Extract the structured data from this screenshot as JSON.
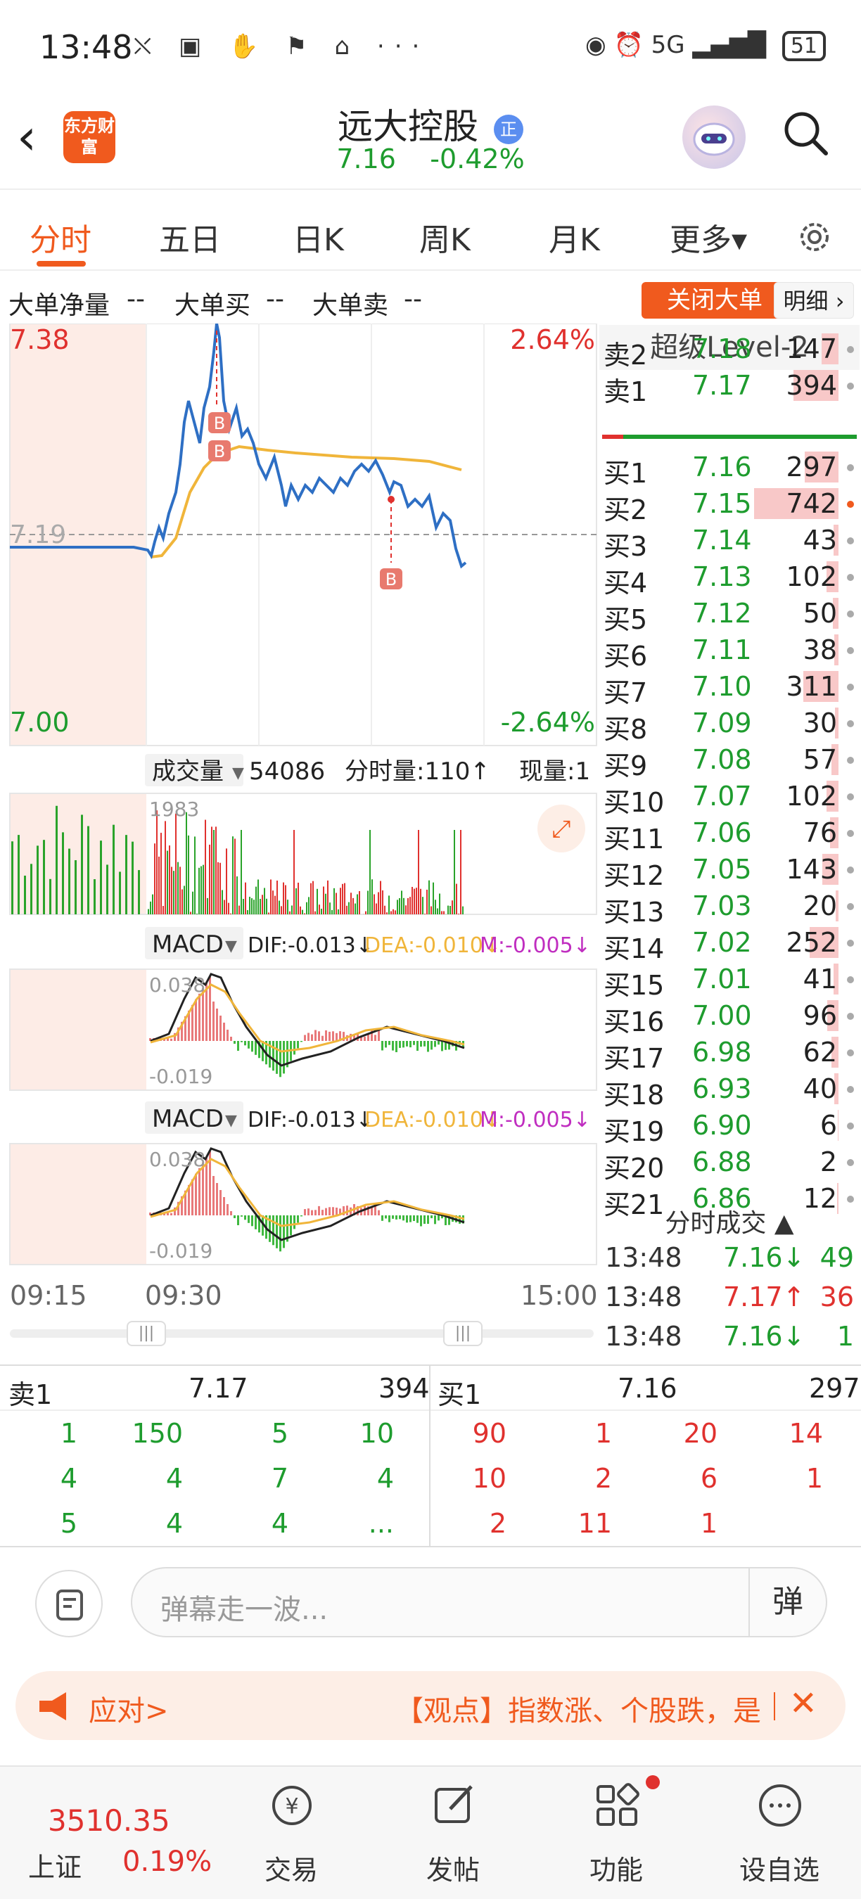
{
  "status_bar": {
    "time": "13:48",
    "icons": "⛌ ▣ ✋ ⚑ ⌂ ···",
    "network": "5G",
    "battery": "51"
  },
  "header": {
    "logo": "东方财富",
    "stock_name": "远大控股",
    "name_tag": "正",
    "price": "7.16",
    "change": "-0.42%"
  },
  "tabs": [
    "分时",
    "五日",
    "日K",
    "周K",
    "月K",
    "更多▾"
  ],
  "large_order": {
    "net_label": "大单净量",
    "net_value": "--",
    "buy_label": "大单买",
    "buy_value": "--",
    "sell_label": "大单卖",
    "sell_value": "--",
    "close_button": "关闭大单",
    "detail_button": "明细"
  },
  "chart_data": [
    {
      "type": "line",
      "title": "",
      "y_labels": {
        "top": "7.38",
        "bottom": "7.00",
        "ref": "7.19",
        "pct_top": "2.64%",
        "pct_bottom": "-2.64%"
      },
      "ylim": [
        7.0,
        7.38
      ],
      "x_labels": [
        "09:15",
        "09:30",
        "15:00"
      ],
      "series": [
        {
          "name": "price",
          "color": "#2e6fc4"
        },
        {
          "name": "average",
          "color": "#f0b53a"
        }
      ],
      "markers": [
        "B",
        "B",
        "B"
      ]
    },
    {
      "type": "bar",
      "title": "成交量",
      "total": "54086",
      "minute_volume_label": "分时量:110↑",
      "current_label": "现量:1",
      "max_label": "1983"
    },
    {
      "type": "bar",
      "title": "MACD",
      "dif": "DIF:-0.013↓",
      "dea": "DEA:-0.010↓",
      "m": "M:-0.005↓",
      "top_label": "0.038",
      "bottom_label": "-0.019"
    },
    {
      "type": "bar",
      "title": "MACD",
      "dif": "DIF:-0.013↓",
      "dea": "DEA:-0.010↓",
      "m": "M:-0.005↓",
      "top_label": "0.038",
      "bottom_label": "-0.019"
    }
  ],
  "orderbook": {
    "title": "超级Level-2",
    "sells": [
      {
        "label": "卖2",
        "price": "7.18",
        "volume": "147",
        "bar": 0.2
      },
      {
        "label": "卖1",
        "price": "7.17",
        "volume": "394",
        "bar": 0.53
      }
    ],
    "buys": [
      {
        "label": "买1",
        "price": "7.16",
        "volume": "297",
        "bar": 0.4
      },
      {
        "label": "买2",
        "price": "7.15",
        "volume": "742",
        "bar": 1.0,
        "hot": true
      },
      {
        "label": "买3",
        "price": "7.14",
        "volume": "43",
        "bar": 0.06
      },
      {
        "label": "买4",
        "price": "7.13",
        "volume": "102",
        "bar": 0.14
      },
      {
        "label": "买5",
        "price": "7.12",
        "volume": "50",
        "bar": 0.07
      },
      {
        "label": "买6",
        "price": "7.11",
        "volume": "38",
        "bar": 0.05
      },
      {
        "label": "买7",
        "price": "7.10",
        "volume": "311",
        "bar": 0.42
      },
      {
        "label": "买8",
        "price": "7.09",
        "volume": "30",
        "bar": 0.04
      },
      {
        "label": "买9",
        "price": "7.08",
        "volume": "57",
        "bar": 0.08
      },
      {
        "label": "买10",
        "price": "7.07",
        "volume": "102",
        "bar": 0.14
      },
      {
        "label": "买11",
        "price": "7.06",
        "volume": "76",
        "bar": 0.1
      },
      {
        "label": "买12",
        "price": "7.05",
        "volume": "143",
        "bar": 0.19
      },
      {
        "label": "买13",
        "price": "7.03",
        "volume": "20",
        "bar": 0.03
      },
      {
        "label": "买14",
        "price": "7.02",
        "volume": "252",
        "bar": 0.34
      },
      {
        "label": "买15",
        "price": "7.01",
        "volume": "41",
        "bar": 0.06
      },
      {
        "label": "买16",
        "price": "7.00",
        "volume": "96",
        "bar": 0.13
      },
      {
        "label": "买17",
        "price": "6.98",
        "volume": "62",
        "bar": 0.08
      },
      {
        "label": "买18",
        "price": "6.93",
        "volume": "40",
        "bar": 0.05
      },
      {
        "label": "买19",
        "price": "6.90",
        "volume": "6",
        "bar": 0.01
      },
      {
        "label": "买20",
        "price": "6.88",
        "volume": "2",
        "bar": 0.0
      },
      {
        "label": "买21",
        "price": "6.86",
        "volume": "12",
        "bar": 0.02
      }
    ],
    "trades_title": "分时成交 ▲",
    "trades": [
      {
        "time": "13:48",
        "price": "7.16↓",
        "volume": "49",
        "dir": "down"
      },
      {
        "time": "13:48",
        "price": "7.17↑",
        "volume": "36",
        "dir": "up"
      },
      {
        "time": "13:48",
        "price": "7.16↓",
        "volume": "1",
        "dir": "down"
      }
    ]
  },
  "depth": {
    "sell_label": "卖1",
    "sell_price": "7.17",
    "sell_total": "394",
    "buy_label": "买1",
    "buy_price": "7.16",
    "buy_total": "297",
    "sell_rows": [
      [
        "1",
        "150",
        "5",
        "10"
      ],
      [
        "4",
        "4",
        "7",
        "4"
      ],
      [
        "5",
        "4",
        "4",
        "..."
      ]
    ],
    "buy_rows": [
      [
        "90",
        "1",
        "20",
        "14"
      ],
      [
        "10",
        "2",
        "6",
        "1"
      ],
      [
        "2",
        "11",
        "1",
        ""
      ]
    ]
  },
  "comment": {
    "placeholder": "弹幕走一波...",
    "danmu_button": "弹"
  },
  "news": {
    "label": "应对>",
    "text": "【观点】指数涨、个股跌，是"
  },
  "bottom_nav": {
    "index_value": "3510.35",
    "index_name": "上证",
    "index_change": "0.19%",
    "items": [
      "交易",
      "发帖",
      "功能",
      "设自选"
    ]
  }
}
